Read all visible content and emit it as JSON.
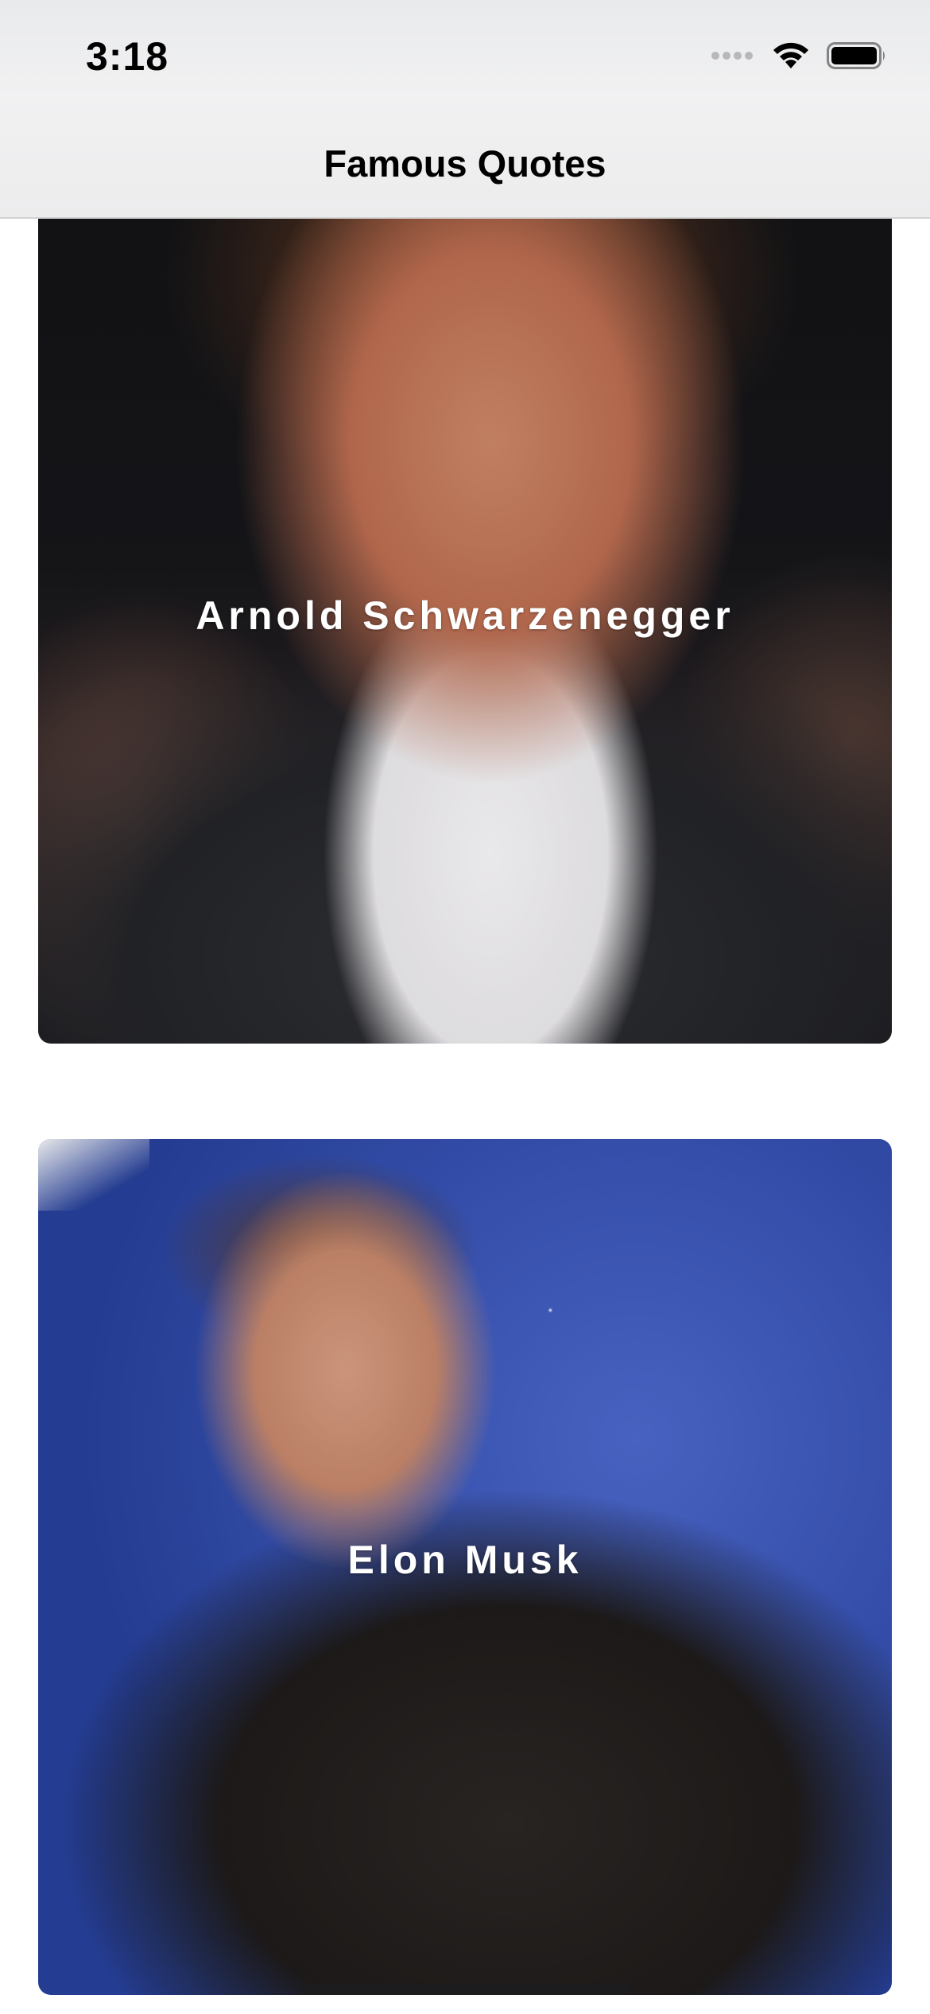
{
  "status_bar": {
    "time": "3:18",
    "icons": [
      "cellular-signal-icon",
      "wifi-icon",
      "battery-icon"
    ]
  },
  "nav": {
    "title": "Famous Quotes"
  },
  "cards": [
    {
      "name": "Arnold Schwarzenegger"
    },
    {
      "name": "Elon Musk"
    }
  ]
}
